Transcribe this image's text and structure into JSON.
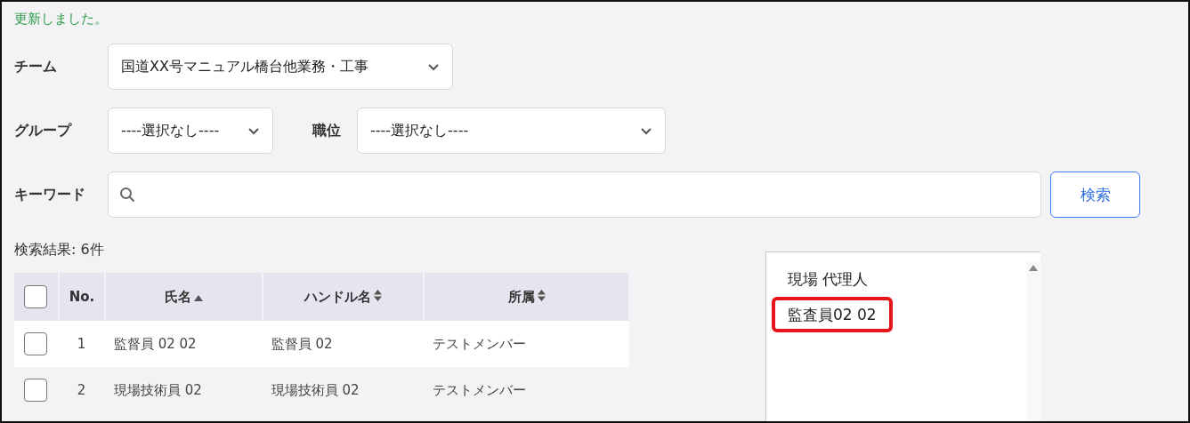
{
  "message": "更新しました。",
  "filters": {
    "team": {
      "label": "チーム",
      "value": "国道XX号マニュアル橋台他業務・工事"
    },
    "group": {
      "label": "グループ",
      "value": "----選択なし----"
    },
    "position": {
      "label": "職位",
      "value": "----選択なし----"
    },
    "keyword": {
      "label": "キーワード"
    }
  },
  "search_button": "検索",
  "result_count": "検索結果: 6件",
  "table": {
    "select_all_checked": false,
    "columns": [
      {
        "label": "No.",
        "sortable": false
      },
      {
        "label": "氏名",
        "sortable": true,
        "sorted_asc": true
      },
      {
        "label": "ハンドル名",
        "sortable": true,
        "sorted_asc": false
      },
      {
        "label": "所属",
        "sortable": true,
        "sorted_asc": false
      }
    ],
    "rows": [
      {
        "no": "1",
        "name": "監督員 02 02",
        "handle": "監督員 02",
        "affiliation": "テストメンバー",
        "checked": false
      },
      {
        "no": "2",
        "name": "現場技術員 02",
        "handle": "現場技術員 02",
        "affiliation": "テストメンバー",
        "checked": false
      }
    ]
  },
  "list_box": {
    "items": [
      {
        "label": "現場 代理人",
        "highlighted": false
      },
      {
        "label": "監査員02 02",
        "highlighted": true
      }
    ]
  }
}
